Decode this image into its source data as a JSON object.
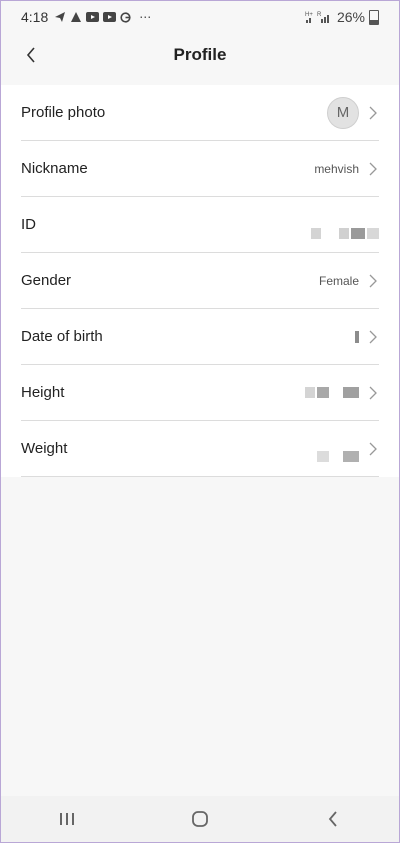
{
  "status_bar": {
    "time": "4:18",
    "battery": "26%",
    "notification_icons": [
      "telegram-icon",
      "app-icon",
      "youtube-icon",
      "youtube-icon",
      "g-icon"
    ],
    "more": "⋯"
  },
  "header": {
    "title": "Profile"
  },
  "profile": {
    "rows": [
      {
        "label": "Profile photo",
        "avatar_initial": "M"
      },
      {
        "label": "Nickname",
        "value": "mehvish"
      },
      {
        "label": "ID"
      },
      {
        "label": "Gender",
        "value": "Female"
      },
      {
        "label": "Date of birth"
      },
      {
        "label": "Height"
      },
      {
        "label": "Weight"
      }
    ]
  },
  "colors": {
    "background": "#f7f7f7",
    "card": "#ffffff",
    "divider": "#dcdcdc"
  }
}
